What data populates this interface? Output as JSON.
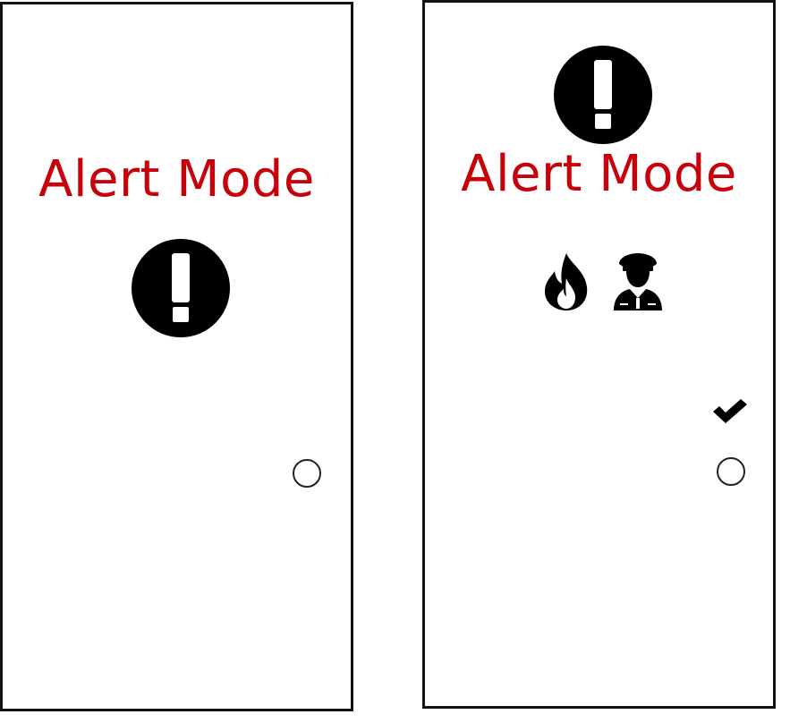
{
  "screens": [
    {
      "id": "left",
      "title": "Alert Mode",
      "icons": [
        "exclamation-icon"
      ],
      "controls": [
        {
          "type": "radio",
          "checked": false
        }
      ]
    },
    {
      "id": "right",
      "title": "Alert Mode",
      "icons": [
        "exclamation-icon",
        "fire-icon",
        "police-officer-icon",
        "checkmark-icon"
      ],
      "controls": [
        {
          "type": "radio",
          "checked": false
        }
      ]
    }
  ],
  "colors": {
    "title": "#c8000a",
    "icon": "#000000",
    "border": "#141414"
  }
}
